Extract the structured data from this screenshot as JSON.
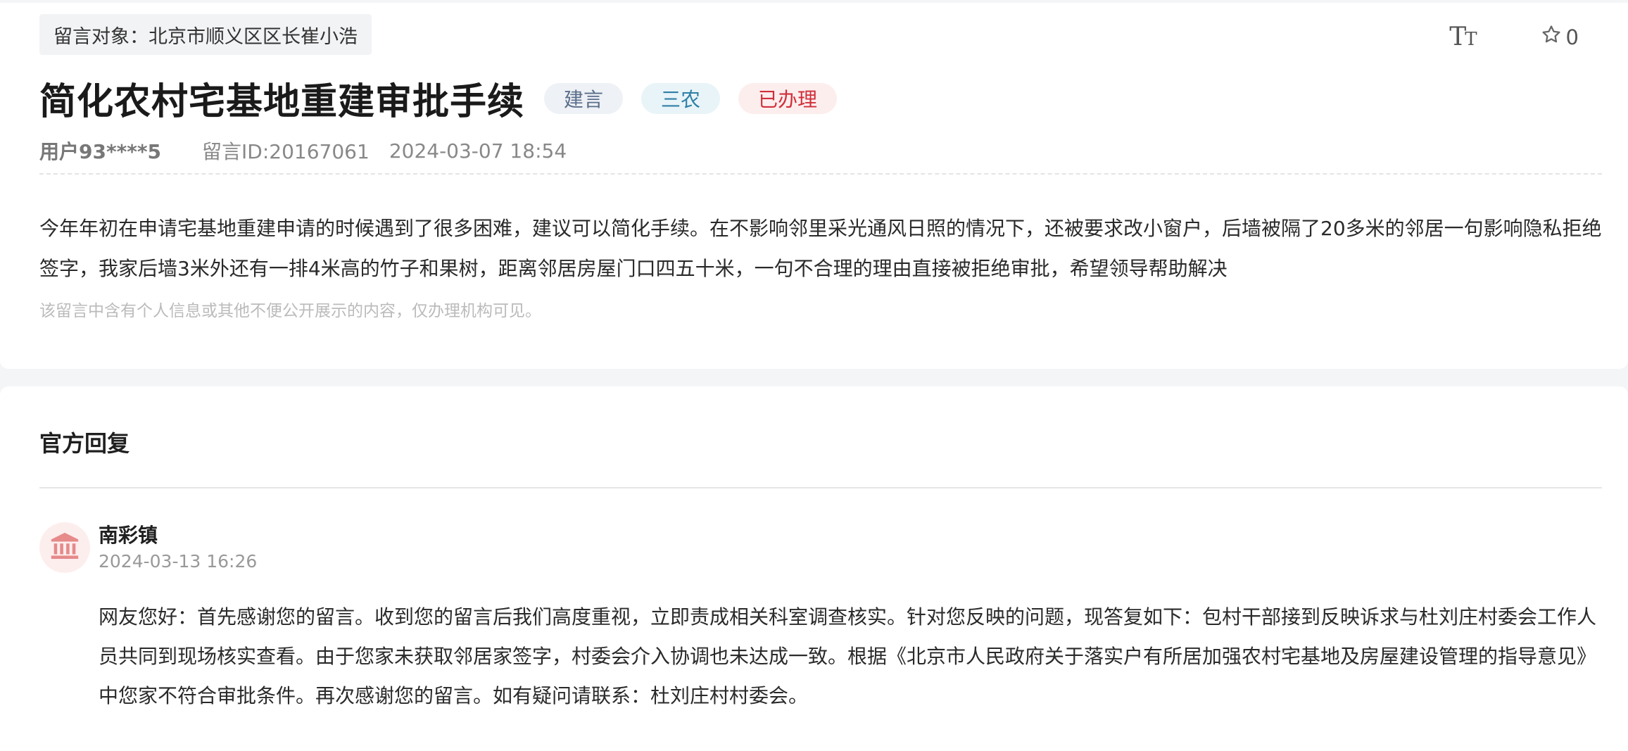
{
  "message": {
    "target_label": "留言对象：北京市顺义区区长崔小浩",
    "title": "简化农村宅基地重建审批手续",
    "tags": {
      "suggestion": "建言",
      "category": "三农",
      "status": "已办理"
    },
    "user": "用户93****5",
    "message_id": "留言ID:20167061",
    "time": "2024-03-07 18:54",
    "body": "今年年初在申请宅基地重建申请的时候遇到了很多困难，建议可以简化手续。在不影响邻里采光通风日照的情况下，还被要求改小窗户，后墙被隔了20多米的邻居一句影响隐私拒绝签字，我家后墙3米外还有一排4米高的竹子和果树，距离邻居房屋门口四五十米，一句不合理的理由直接被拒绝审批，希望领导帮助解决",
    "privacy_note": "该留言中含有个人信息或其他不便公开展示的内容，仅办理机构可见。"
  },
  "toolbar": {
    "font_icon_big": "T",
    "font_icon_small": "T",
    "favorite_icon": "star-outline-icon",
    "favorite_count": "0"
  },
  "reply": {
    "section_title": "官方回复",
    "responder_icon": "government-building-icon",
    "responder_name": "南彩镇",
    "time": "2024-03-13 16:26",
    "body": "网友您好：首先感谢您的留言。收到您的留言后我们高度重视，立即责成相关科室调查核实。针对您反映的问题，现答复如下：包村干部接到反映诉求与杜刘庄村委会工作人员共同到现场核实查看。由于您家未获取邻居家签字，村委会介入协调也未达成一致。根据《北京市人民政府关于落实户有所居加强农村宅基地及房屋建设管理的指导意见》中您家不符合审批条件。再次感谢您的留言。如有疑问请联系：杜刘庄村村委会。"
  },
  "colors": {
    "status_red": "#d0303a",
    "category_blue": "#2f7fa6",
    "suggestion_gray_blue": "#5a6e8c",
    "avatar_icon": "#e68a8a"
  }
}
